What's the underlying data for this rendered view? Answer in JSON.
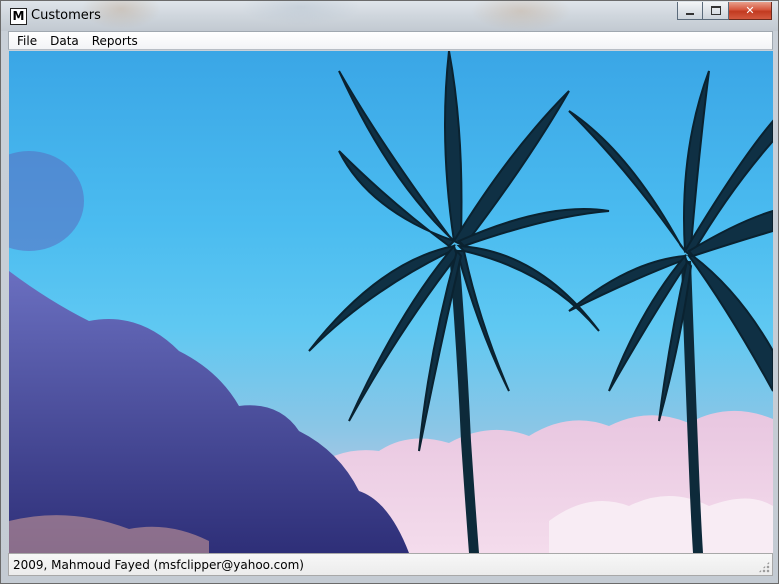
{
  "window": {
    "title": "Customers",
    "icon_letter": "M"
  },
  "menu": {
    "items": [
      {
        "label": "File"
      },
      {
        "label": "Data"
      },
      {
        "label": "Reports"
      }
    ]
  },
  "background_image": {
    "subject": "palm trees against blue sky with clouds"
  },
  "status": {
    "text": "2009, Mahmoud Fayed (msfclipper@yahoo.com)"
  },
  "colors": {
    "sky_top": "#3aa6e6",
    "sky_mid": "#5fc8f2",
    "palm": "#0d2a3a",
    "cloud_dark": "#3c3f8a",
    "cloud_pink": "#e6c4dc",
    "close_button": "#c8452c"
  }
}
